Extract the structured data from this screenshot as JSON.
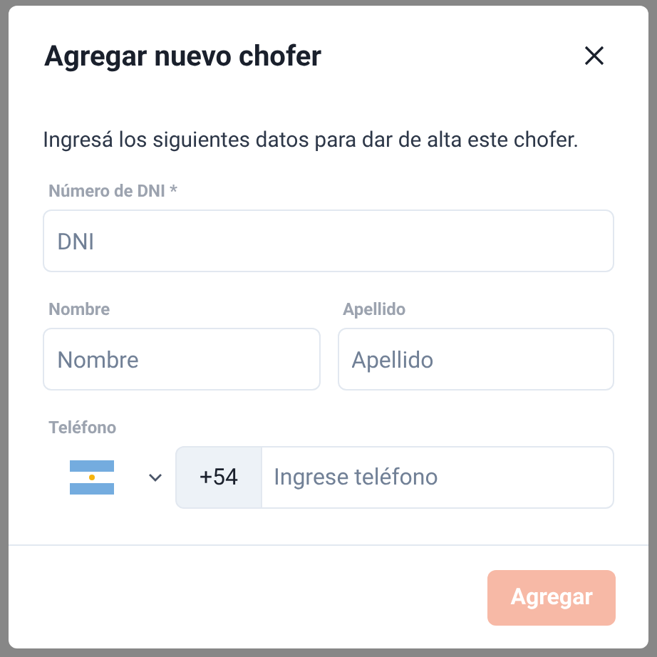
{
  "dialog": {
    "title": "Agregar nuevo chofer",
    "description": "Ingresá los siguientes datos para dar de alta este chofer."
  },
  "fields": [
    {
      "label": "Número de DNI *",
      "placeholder": "DNI"
    },
    {
      "label": "Nombre",
      "placeholder": "Nombre"
    },
    {
      "label": "Apellido",
      "placeholder": "Apellido"
    }
  ],
  "phone": {
    "label": "Teléfono",
    "prefix": "+54",
    "placeholder": "Ingrese teléfono"
  },
  "submit": {
    "label": "Agregar",
    "disabled": true
  }
}
